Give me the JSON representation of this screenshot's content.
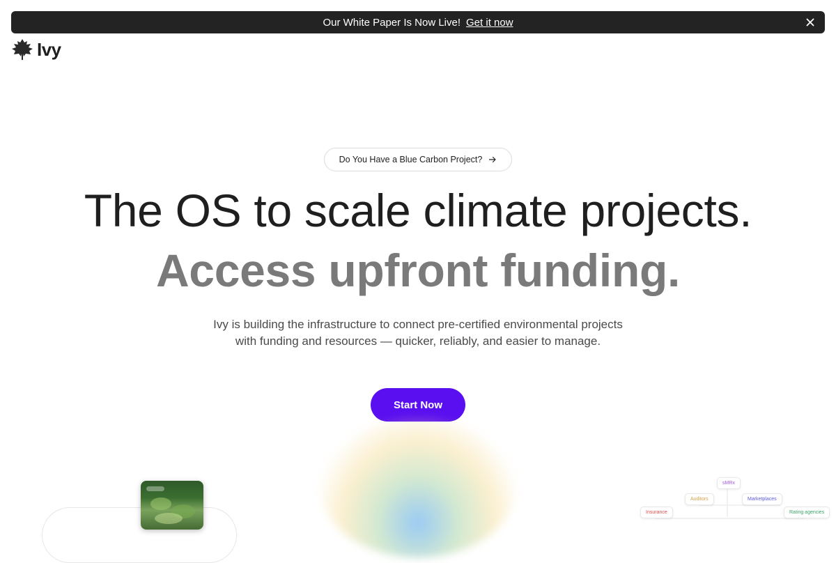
{
  "announcement": {
    "message": "Our White Paper Is Now Live!",
    "link_label": "Get it now"
  },
  "brand": {
    "name": "Ivy"
  },
  "hero": {
    "pill_label": "Do You Have a Blue Carbon Project?",
    "headline": "The OS to scale climate projects.",
    "subheadline": "Access upfront funding.",
    "description": "Ivy is building the infrastructure to connect pre-certified environmental projects with funding and resources — quicker, reliably, and easier to manage.",
    "cta_label": "Start Now"
  },
  "diagram": {
    "nodes": [
      {
        "label": "sMRx",
        "color": "#a25be0"
      },
      {
        "label": "Auditors",
        "color": "#d4a24a"
      },
      {
        "label": "Marketplaces",
        "color": "#5a5ad8"
      },
      {
        "label": "Insurance",
        "color": "#e04b4b"
      },
      {
        "label": "Rating agencies",
        "color": "#3aa36b"
      }
    ]
  },
  "colors": {
    "accent": "#5a0ff0",
    "announcement_bg": "#232323",
    "text_primary": "#1f1f1f",
    "text_muted": "#7a7a7a"
  }
}
